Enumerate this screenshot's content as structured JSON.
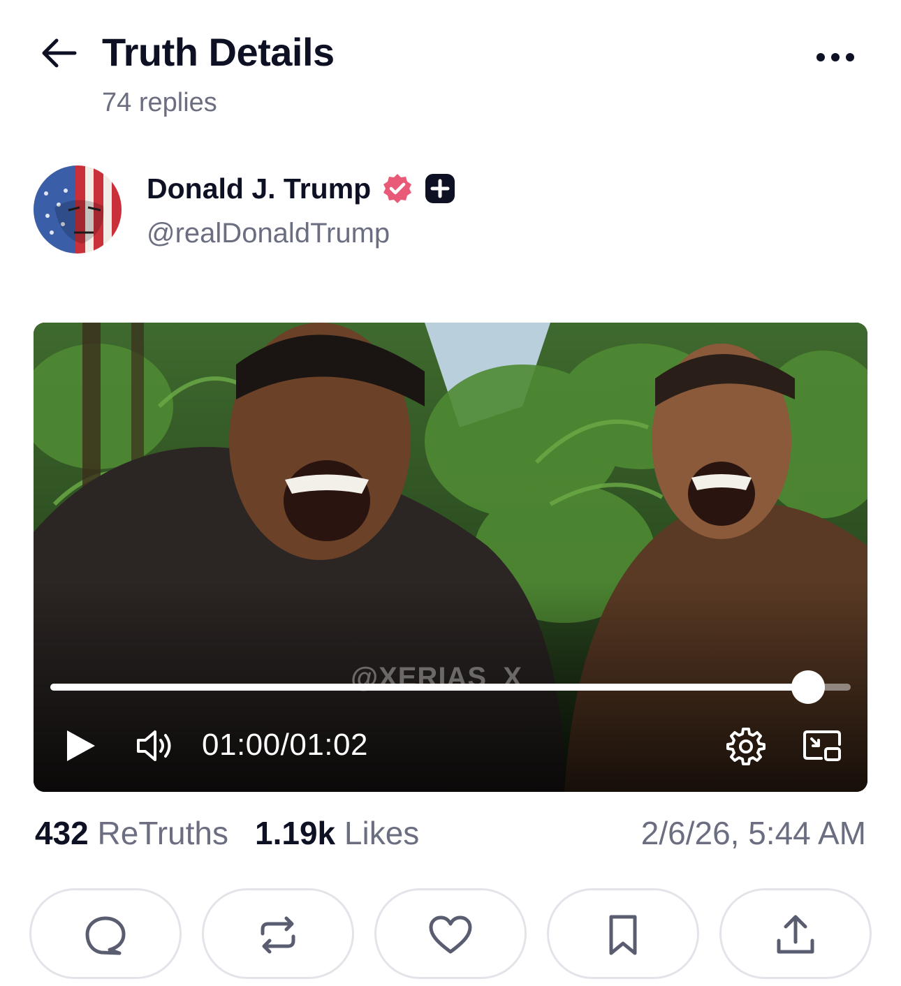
{
  "header": {
    "title": "Truth Details",
    "reply_count": "74 replies"
  },
  "post": {
    "author_name": "Donald J. Trump",
    "handle": "@realDonaldTrump",
    "verified_color": "#e85a78",
    "video": {
      "watermark": "@XERIAS_X",
      "current_time": "01:00",
      "separator": "/",
      "duration": "01:02",
      "progress_fraction": 0.947
    },
    "stats": {
      "retruths_count": "432",
      "retruths_label": "ReTruths",
      "likes_count": "1.19k",
      "likes_label": "Likes"
    },
    "timestamp": "2/6/26, 5:44 AM"
  },
  "actions": [
    {
      "icon": "reply-icon"
    },
    {
      "icon": "retruth-icon"
    },
    {
      "icon": "like-icon"
    },
    {
      "icon": "bookmark-icon"
    },
    {
      "icon": "share-icon"
    }
  ]
}
